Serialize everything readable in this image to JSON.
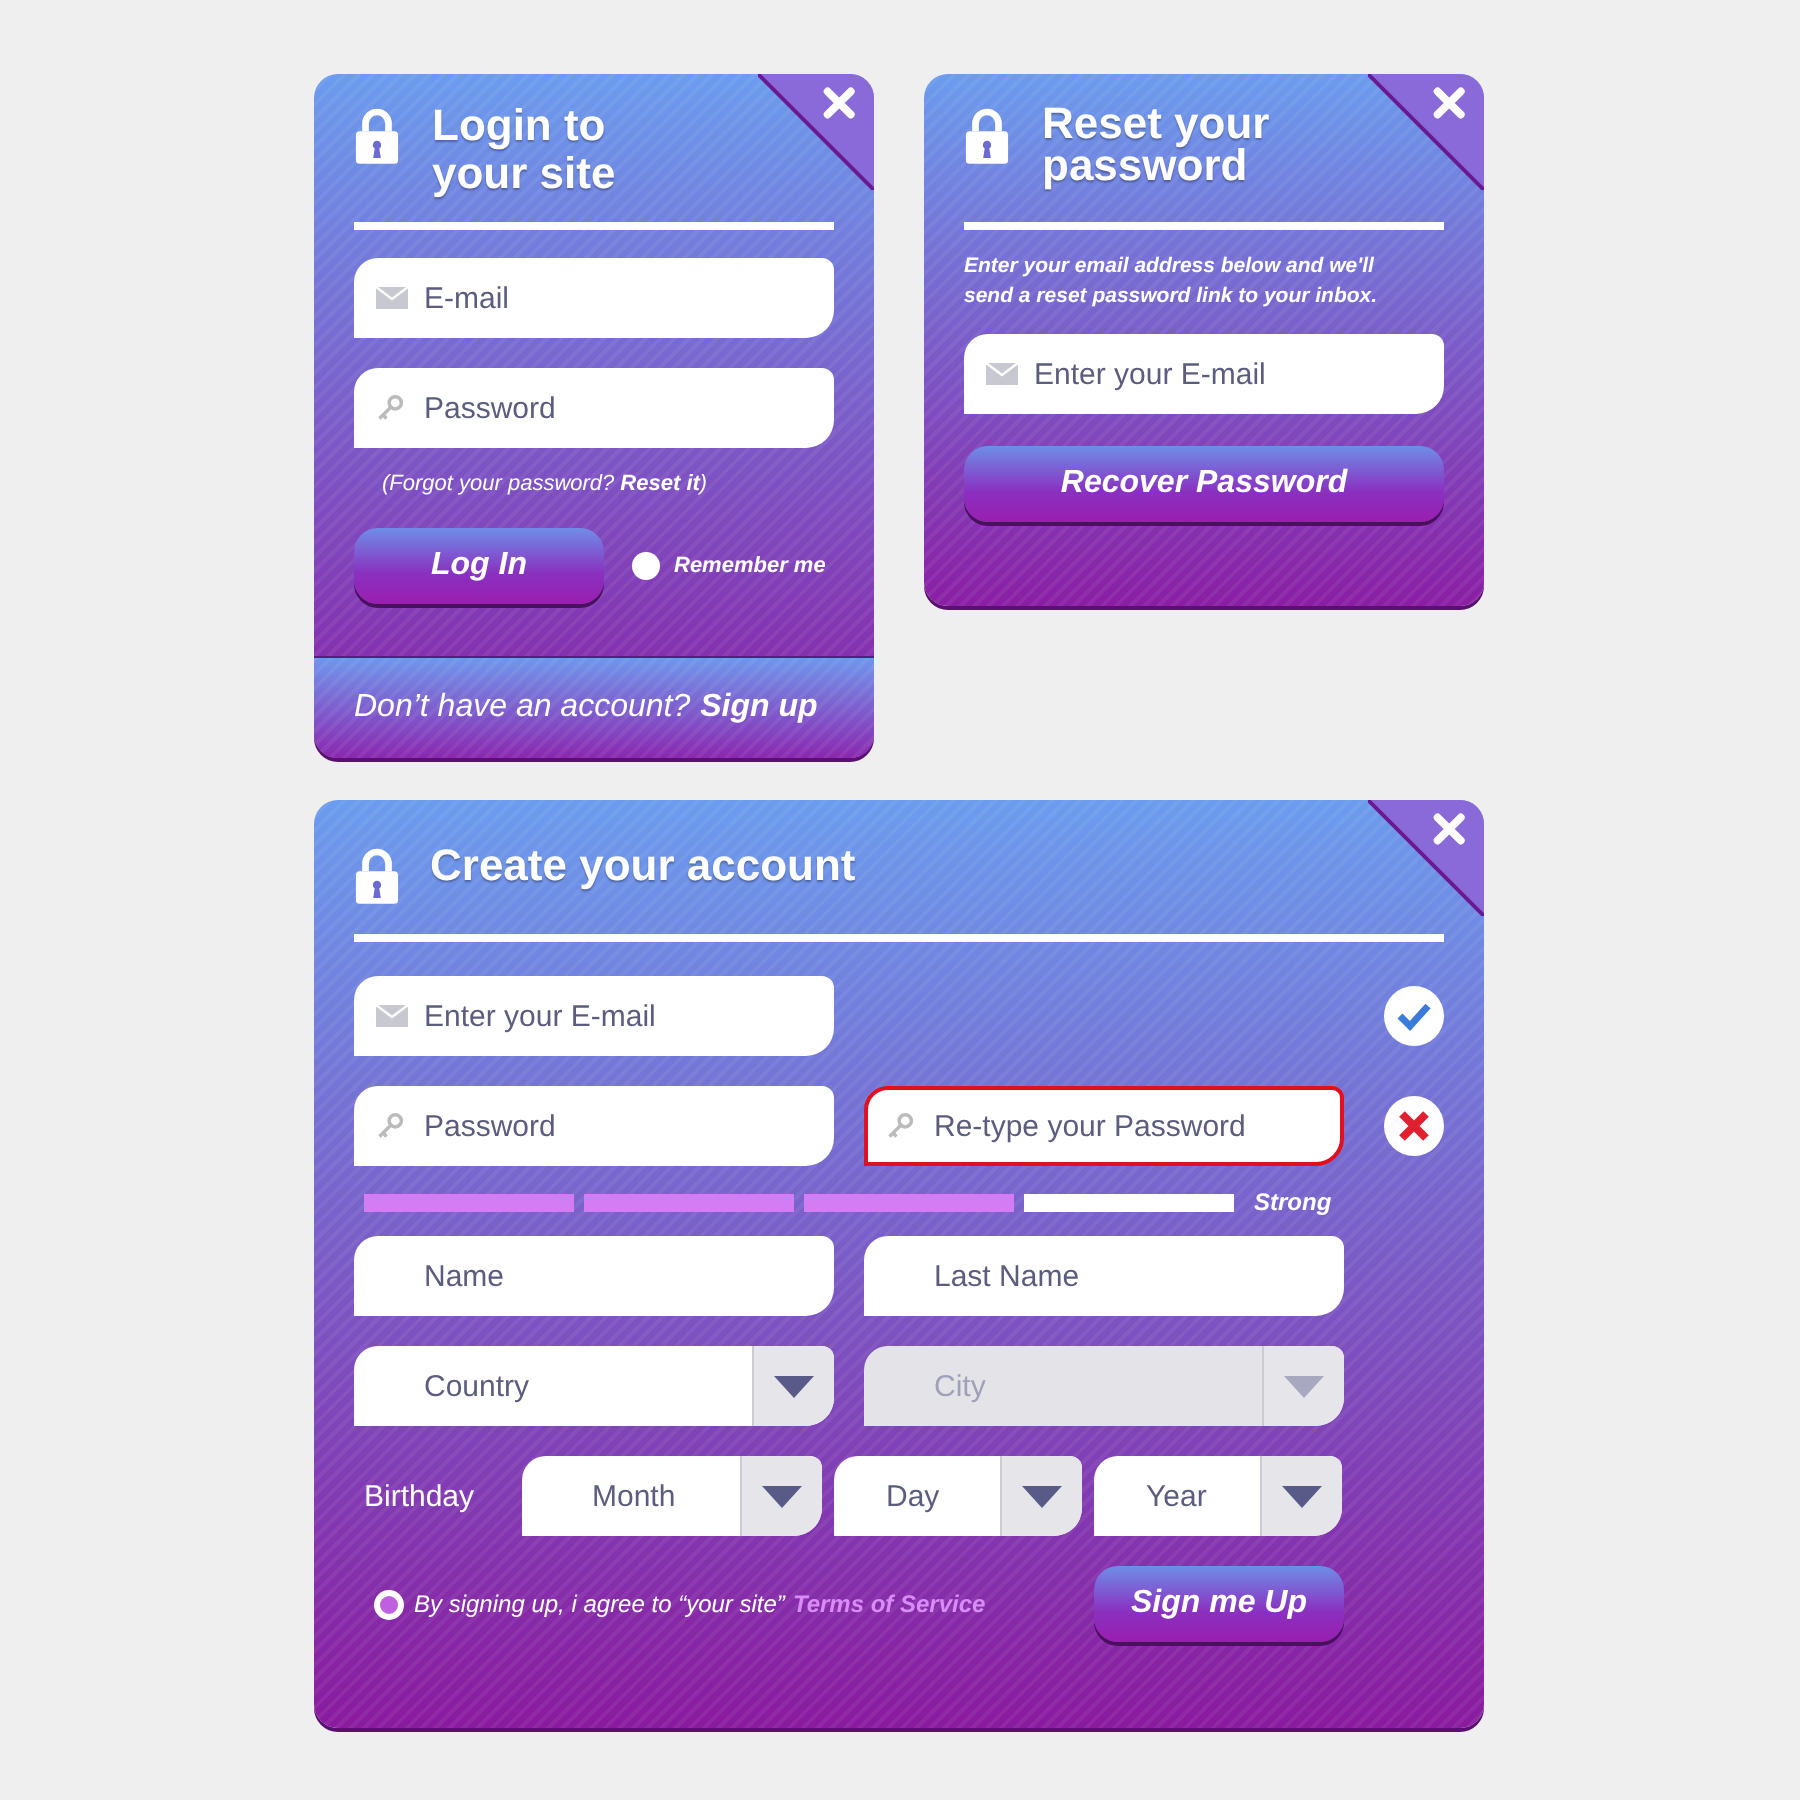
{
  "login": {
    "title": "Login to your site",
    "fields": [
      {
        "kind": "email",
        "placeholder": "E-mail"
      },
      {
        "kind": "password",
        "placeholder": "Password"
      }
    ],
    "forgot": {
      "text": "(Forgot your password?",
      "link": "Reset it",
      "end": ")"
    },
    "button": "Log In",
    "remember": {
      "label": "Remember me",
      "checked": false
    },
    "footer": {
      "text": "Don’t have an account?",
      "link": "Sign up"
    }
  },
  "reset": {
    "title": "Reset your password",
    "description": "Enter your email address below and we'll send a reset password link to your inbox.",
    "field": {
      "kind": "email",
      "placeholder": "Enter your E-mail"
    },
    "button": "Recover Password"
  },
  "signup": {
    "title": "Create your account",
    "fields": [
      {
        "kind": "email",
        "placeholder": "Enter your E-mail",
        "valid": true
      },
      {
        "kind": "password",
        "placeholder": "Password"
      },
      {
        "kind": "password",
        "placeholder": "Re-type your Password",
        "valid": false
      },
      {
        "kind": "text",
        "placeholder": "Name"
      },
      {
        "kind": "text",
        "placeholder": "Last Name"
      }
    ],
    "strength": {
      "level": 0.75,
      "label": "Strong"
    },
    "location": [
      {
        "label": "Country",
        "disabled": false
      },
      {
        "label": "City",
        "disabled": true
      }
    ],
    "birthday": {
      "label": "Birthday",
      "selects": [
        "Month",
        "Day",
        "Year"
      ]
    },
    "terms": {
      "checked": true,
      "text": "By signing up, i agree to “your site”",
      "link": "Terms of Service"
    },
    "button": "Sign me Up"
  }
}
